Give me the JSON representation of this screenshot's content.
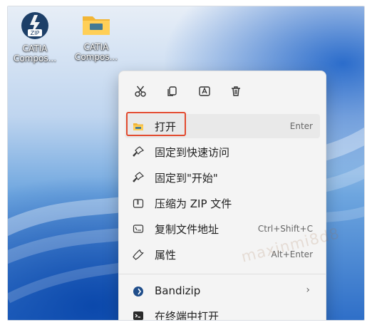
{
  "desktop": {
    "icons": [
      {
        "label": "CATIA\nCompos...",
        "kind": "zip-archive-icon"
      },
      {
        "label": "CATIA\nCompos...",
        "kind": "folder-icon"
      }
    ]
  },
  "context_menu": {
    "toolbar": [
      "cut-icon",
      "copy-icon",
      "rename-icon",
      "delete-icon"
    ],
    "items": [
      {
        "label": "打开",
        "accel": "Enter",
        "icon": "folder-icon"
      },
      {
        "label": "固定到快速访问",
        "accel": "",
        "icon": "pin-icon"
      },
      {
        "label": "固定到\"开始\"",
        "accel": "",
        "icon": "pin-icon"
      },
      {
        "label": "压缩为 ZIP 文件",
        "accel": "",
        "icon": "zip-icon"
      },
      {
        "label": "复制文件地址",
        "accel": "Ctrl+Shift+C",
        "icon": "path-icon"
      },
      {
        "label": "属性",
        "accel": "Alt+Enter",
        "icon": "wrench-icon"
      },
      {
        "label": "Bandizip",
        "accel": "",
        "icon": "bandizip-icon",
        "submenu": true
      },
      {
        "label": "在终端中打开",
        "accel": "",
        "icon": "terminal-icon"
      }
    ]
  },
  "watermark": "maxinmi8d8",
  "colors": {
    "highlight_border": "#e24a2f",
    "menu_bg": "#f4f4f4"
  }
}
